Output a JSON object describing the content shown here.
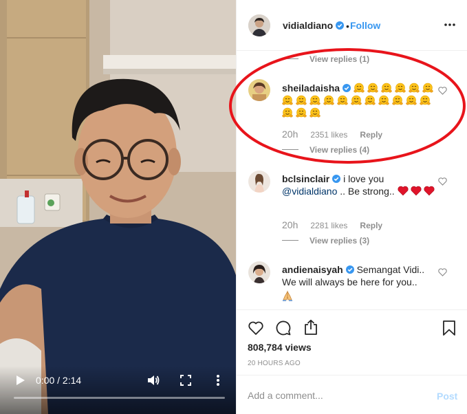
{
  "video": {
    "time": "0:00 / 2:14",
    "progress": 0.0,
    "icons": {
      "play": "play-icon",
      "volume": "volume-icon",
      "fullscreen": "fullscreen-icon",
      "more": "more-vertical-icon"
    }
  },
  "header": {
    "username": "vidialdiano",
    "separator": "•",
    "follow_label": "Follow",
    "more_icon": "more-horizontal-icon"
  },
  "comments": [
    {
      "view_replies": "View replies (1)"
    },
    {
      "username": "sheiladaisha",
      "emoji_count": 20,
      "emoji_icon": "hugging-face-emoji",
      "age": "20h",
      "likes": "2351 likes",
      "reply_label": "Reply",
      "view_replies": "View replies (4)"
    },
    {
      "username": "bclsinclair",
      "text_1": "i love you",
      "mention": "@vidialdiano",
      "text_2": " .. Be strong.. ",
      "hearts": 3,
      "age": "20h",
      "likes": "2281 likes",
      "reply_label": "Reply",
      "view_replies": "View replies (3)"
    },
    {
      "username": "andienaisyah",
      "text_1": "Semangat Vidi..",
      "text_2": "We will always be here for you..",
      "emoji_icon": "folded-hands-emoji"
    }
  ],
  "actions": {
    "views": "808,784 views",
    "posted": "20 HOURS AGO",
    "icons": [
      "heart-icon",
      "comment-icon",
      "share-icon",
      "bookmark-icon"
    ]
  },
  "add_comment": {
    "placeholder": "Add a comment...",
    "post_label": "Post"
  },
  "colors": {
    "accent": "#3897f0",
    "verified": "#3897f0",
    "annotation": "#e8141b",
    "muted": "#8e8e8e",
    "post_disabled": "#b3dbff"
  }
}
